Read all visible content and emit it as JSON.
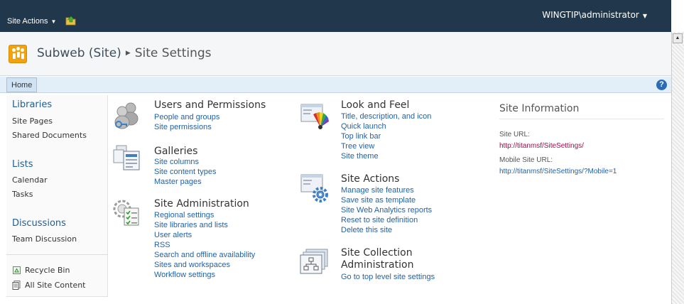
{
  "topbar": {
    "site_actions": "Site Actions",
    "user": "WINGTIP\\administrator"
  },
  "title": {
    "site_name": "Subweb (Site)",
    "page": "Site Settings"
  },
  "topnav": {
    "home_tab": "Home"
  },
  "quicklaunch": {
    "libraries_heading": "Libraries",
    "libraries": [
      "Site Pages",
      "Shared Documents"
    ],
    "lists_heading": "Lists",
    "lists": [
      "Calendar",
      "Tasks"
    ],
    "discussions_heading": "Discussions",
    "discussions": [
      "Team Discussion"
    ],
    "recycle_bin": "Recycle Bin",
    "all_site_content": "All Site Content"
  },
  "sections": {
    "users": {
      "title": "Users and Permissions",
      "links": [
        "People and groups",
        "Site permissions"
      ]
    },
    "galleries": {
      "title": "Galleries",
      "links": [
        "Site columns",
        "Site content types",
        "Master pages"
      ]
    },
    "site_admin": {
      "title": "Site Administration",
      "links": [
        "Regional settings",
        "Site libraries and lists",
        "User alerts",
        "RSS",
        "Search and offline availability",
        "Sites and workspaces",
        "Workflow settings"
      ]
    },
    "look_feel": {
      "title": "Look and Feel",
      "links": [
        "Title, description, and icon",
        "Quick launch",
        "Top link bar",
        "Tree view",
        "Site theme"
      ]
    },
    "site_actions": {
      "title": "Site Actions",
      "links": [
        "Manage site features",
        "Save site as template",
        "Site Web Analytics reports",
        "Reset to site definition",
        "Delete this site"
      ]
    },
    "collection_admin": {
      "title_line1": "Site Collection",
      "title_line2": "Administration",
      "links": [
        "Go to top level site settings"
      ]
    }
  },
  "site_info": {
    "title": "Site Information",
    "site_url_label": "Site URL:",
    "site_url": "http://titanmsf/SiteSettings/",
    "mobile_url_label": "Mobile Site URL:",
    "mobile_url": "http://titanmsf/SiteSettings/?Mobile=1"
  },
  "colors": {
    "topbar": "#21374c",
    "link": "#2262a8",
    "heading": "#1f5d96",
    "site_url": "#a30a4c"
  }
}
